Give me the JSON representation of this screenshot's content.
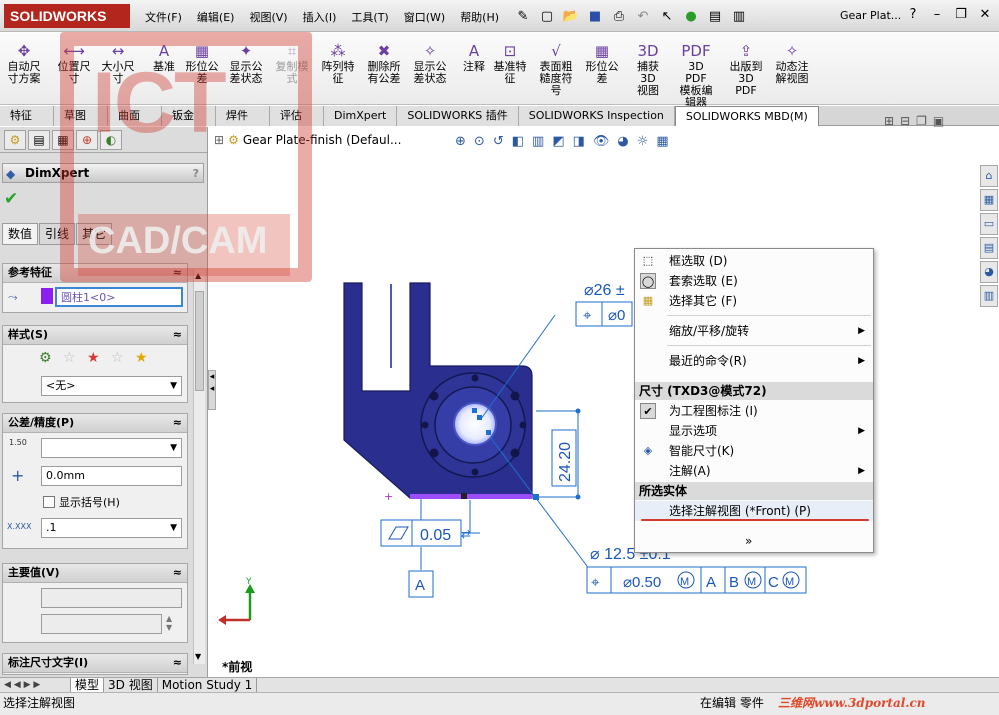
{
  "app": {
    "logo_text": "SOLIDWORKS",
    "doc_title": "Gear Plat...",
    "menu": [
      "文件(F)",
      "编辑(E)",
      "视图(V)",
      "插入(I)",
      "工具(T)",
      "窗口(W)",
      "帮助(H)"
    ]
  },
  "ribbon": {
    "items": [
      {
        "label": "自动尺\n寸方案",
        "icon": "auto-dimension-icon"
      },
      {
        "label": "位置尺\n寸",
        "icon": "location-dim-icon"
      },
      {
        "label": "大小尺\n寸",
        "icon": "size-dim-icon"
      },
      {
        "label": "基准",
        "icon": "datum-icon"
      },
      {
        "label": "形位公\n差",
        "icon": "geometric-tolerance-icon"
      },
      {
        "label": "显示公\n差状态",
        "icon": "show-tolerance-status-icon"
      },
      {
        "label": "复制模\n式",
        "icon": "copy-scheme-icon"
      },
      {
        "label": "阵列特\n征",
        "icon": "pattern-feature-icon"
      },
      {
        "label": "删除所\n有公差",
        "icon": "delete-all-tolerances-icon"
      },
      {
        "label": "显示公\n差状态",
        "icon": "show-tolerance-status2-icon"
      },
      {
        "label": "注释",
        "icon": "note-icon"
      },
      {
        "label": "基准特\n征",
        "icon": "datum-feature-icon"
      },
      {
        "label": "表面粗\n糙度符\n号",
        "icon": "surface-finish-icon"
      },
      {
        "label": "形位公\n差",
        "icon": "geometric-tolerance2-icon"
      },
      {
        "label": "捕获 3D\n视图",
        "icon": "capture-3d-view-icon"
      },
      {
        "label": "3D PDF\n模板编\n辑器",
        "icon": "pdf-template-icon"
      },
      {
        "label": "出版到\n3D PDF",
        "icon": "publish-3d-pdf-icon"
      },
      {
        "label": "动态注\n解视图",
        "icon": "dynamic-annotation-icon"
      }
    ]
  },
  "command_tabs": [
    "特征",
    "草图",
    "曲面",
    "钣金",
    "焊件",
    "评估",
    "DimXpert",
    "SOLIDWORKS 插件",
    "SOLIDWORKS Inspection",
    "SOLIDWORKS MBD(M)"
  ],
  "active_command_tab": "SOLIDWORKS MBD(M)",
  "property_manager": {
    "title": "DimXpert",
    "help": "?",
    "subtabs": [
      "数值",
      "引线",
      "其它"
    ],
    "reference_feature": {
      "header": "参考特征",
      "value": "圆柱1<0>"
    },
    "style": {
      "header": "样式(S)",
      "dropdown": "<无>"
    },
    "tolerance": {
      "header": "公差/精度(P)",
      "tol_icon_text": "1.50",
      "value": "0.0mm",
      "checkbox_label": "显示括号(H)",
      "precision": ".1"
    },
    "primary_value": {
      "header": "主要值(V)"
    },
    "dim_text": {
      "header": "标注尺寸文字(I)"
    }
  },
  "viewport": {
    "tree_label": "Gear Plate-finish  (Defaul...",
    "view_label": "*前视"
  },
  "annotations": {
    "dim_top": "⌀26 ±",
    "dim_top_tail": "⌀0",
    "dim_vertical": "24.20",
    "flatness": "0.05",
    "datum": "A",
    "dim_hole": "⌀ 12.5 ±0.1",
    "fcf_tolerance": "⌀0.50",
    "fcf_mod": "M",
    "fcf_ref_a": "A",
    "fcf_ref_b": "B",
    "fcf_ref_c": "C",
    "axis_y": "Y",
    "axis_x": "X"
  },
  "context_menu": {
    "items1": [
      {
        "label": "框选取 (D)",
        "icon": "box-select-icon"
      },
      {
        "label": "套索选取 (E)",
        "icon": "lasso-select-icon"
      },
      {
        "label": "选择其它 (F)",
        "icon": "select-other-icon"
      }
    ],
    "zoom": "缩放/平移/旋转",
    "recent": "最近的命令(R)",
    "header_dim": "尺寸 (TXD3@模式72)",
    "items2": [
      {
        "label": "为工程图标注 (I)",
        "icon": "check-icon"
      },
      {
        "label": "显示选项",
        "icon": ""
      },
      {
        "label": "智能尺寸(K)",
        "icon": "smart-dimension-icon"
      },
      {
        "label": "注解(A)",
        "icon": ""
      }
    ],
    "header_entity": "所选实体",
    "select_view": "选择注解视图 (*Front) (P)",
    "more": "»"
  },
  "bottom_tabs": [
    "模型",
    "3D 视图",
    "Motion Study 1"
  ],
  "status": {
    "left": "选择注解视图",
    "editing": "在编辑 零件",
    "site": "三维网www.3dportal.cn"
  },
  "watermark": {
    "top": "ICT",
    "bottom": "CAD/CAM"
  },
  "colors": {
    "part": "#2a2f8f",
    "dim_line": "#1e6fd1",
    "dim_text": "#1a57b8",
    "accent_red": "#d43a2f"
  }
}
